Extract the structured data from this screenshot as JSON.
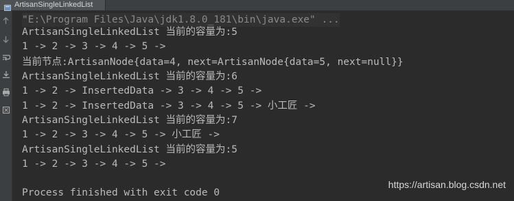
{
  "tab": {
    "title": "ArtisanSingleLinkedList",
    "icon": "run-config-icon"
  },
  "toolbar": [
    {
      "icon": "up-arrow-icon"
    },
    {
      "icon": "down-arrow-icon"
    },
    {
      "icon": "soft-wrap-icon"
    },
    {
      "icon": "scroll-to-end-icon"
    },
    {
      "icon": "print-icon"
    },
    {
      "icon": "clear-all-icon"
    }
  ],
  "console": {
    "command": "\"E:\\Program Files\\Java\\jdk1.8.0_181\\bin\\java.exe\" ...",
    "lines": [
      "ArtisanSingleLinkedList 当前的容量为:5",
      "1 -> 2 -> 3 -> 4 -> 5 ->",
      "当前节点:ArtisanNode{data=4, next=ArtisanNode{data=5, next=null}}",
      "ArtisanSingleLinkedList 当前的容量为:6",
      "1 -> 2 -> InsertedData -> 3 -> 4 -> 5 ->",
      "1 -> 2 -> InsertedData -> 3 -> 4 -> 5 -> 小工匠 ->",
      "ArtisanSingleLinkedList 当前的容量为:7",
      "1 -> 2 -> 3 -> 4 -> 5 -> 小工匠 ->",
      "ArtisanSingleLinkedList 当前的容量为:5",
      "1 -> 2 -> 3 -> 4 -> 5 ->",
      "",
      "Process finished with exit code 0"
    ]
  },
  "watermark": "https://artisan.blog.csdn.net"
}
